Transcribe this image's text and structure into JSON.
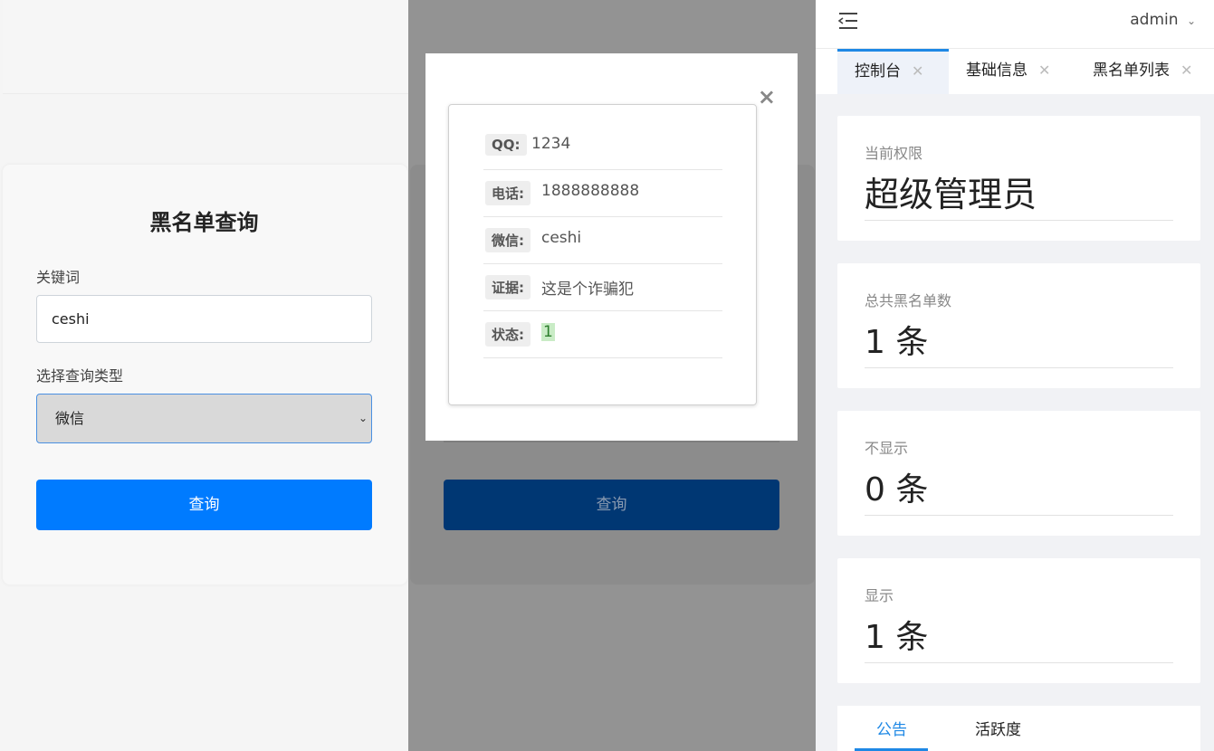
{
  "search_form": {
    "title": "黑名单查询",
    "keyword_label": "关键词",
    "keyword_value": "ceshi",
    "type_label": "选择查询类型",
    "type_selected": "微信",
    "submit_label": "查询"
  },
  "result_modal": {
    "close": "×",
    "rows": [
      {
        "key": "QQ:",
        "value": "1234"
      },
      {
        "key": "电话:",
        "value": "1888888888"
      },
      {
        "key": "微信:",
        "value": "ceshi"
      },
      {
        "key": "证据:",
        "value": "这是个诈骗犯"
      },
      {
        "key": "状态:",
        "value": "1"
      }
    ],
    "behind_button": "查询"
  },
  "dashboard": {
    "user": "admin",
    "tabs": [
      {
        "label": "控制台",
        "active": true
      },
      {
        "label": "基础信息",
        "active": false
      },
      {
        "label": "黑名单列表",
        "active": false
      }
    ],
    "stats": [
      {
        "caption": "当前权限",
        "value": "超级管理员"
      },
      {
        "caption": "总共黑名单数",
        "value": "1 条"
      },
      {
        "caption": "不显示",
        "value": "0 条"
      },
      {
        "caption": "显示",
        "value": "1 条"
      }
    ],
    "bottom_tabs": [
      "公告",
      "活跃度"
    ],
    "accent": "#1e88e5"
  }
}
